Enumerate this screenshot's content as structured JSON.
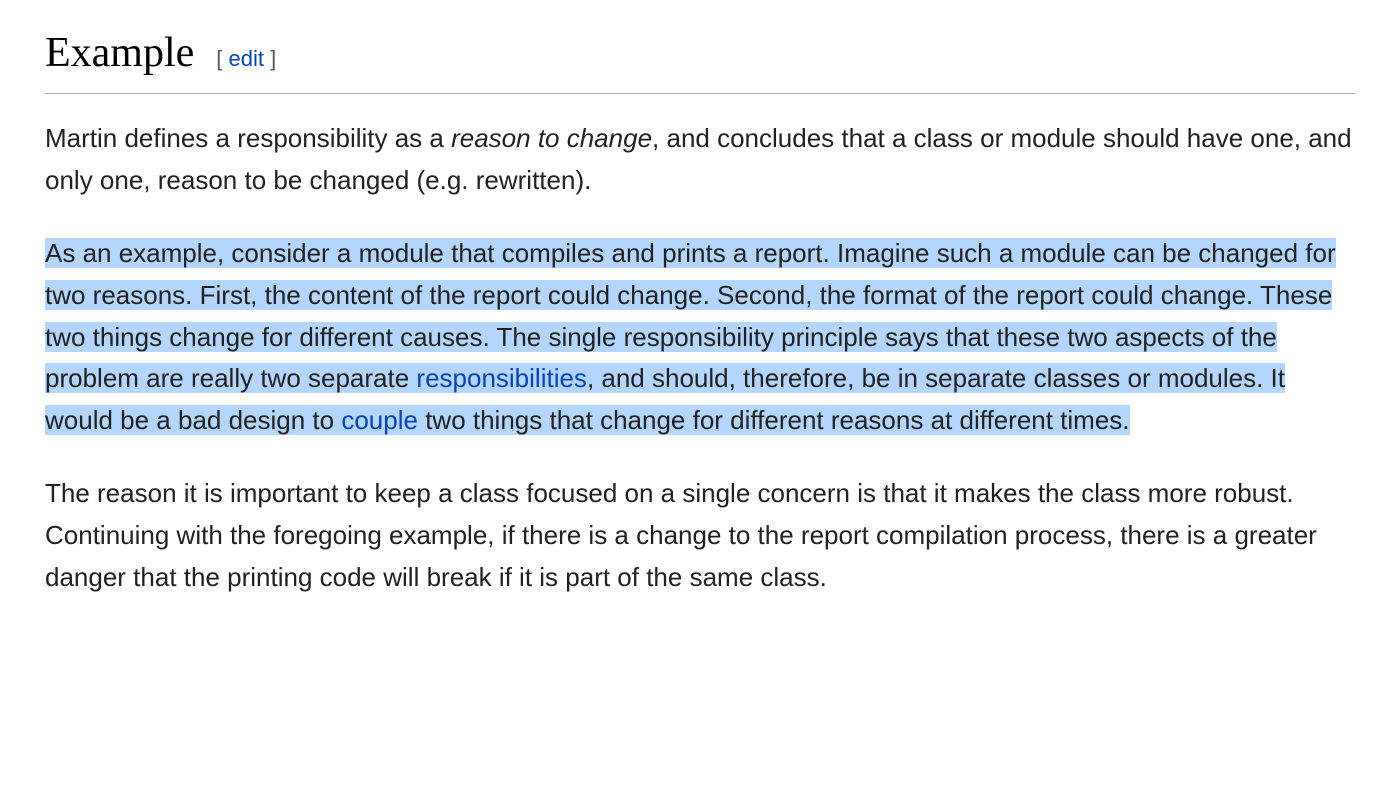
{
  "heading": {
    "title": "Example",
    "edit_open": "[ ",
    "edit_label": "edit",
    "edit_close": " ]"
  },
  "para1": {
    "t1": "Martin defines a responsibility as a ",
    "italic": "reason to change",
    "t2": ", and concludes that a class or module should have one, and only one, reason to be changed (e.g. rewritten)."
  },
  "para2": {
    "t1": "As an example, consider a module that compiles and prints a report. Imagine such a module can be changed for two reasons. First, the content of the report could change. Second, the format of the report could change. These two things change for different causes. The single responsibility principle says that these two aspects of the problem are really two separate ",
    "link1": "responsibilities",
    "t2": ", and should, therefore, be in separate classes or modules. It would be a bad design to ",
    "link2": "couple",
    "t3": " two things that change for different reasons at different times."
  },
  "para3": {
    "t1": "The reason it is important to keep a class focused on a single concern is that it makes the class more robust. Continuing with the foregoing example, if there is a change to the report compilation process, there is a greater danger that the printing code will break if it is part of the same class."
  }
}
